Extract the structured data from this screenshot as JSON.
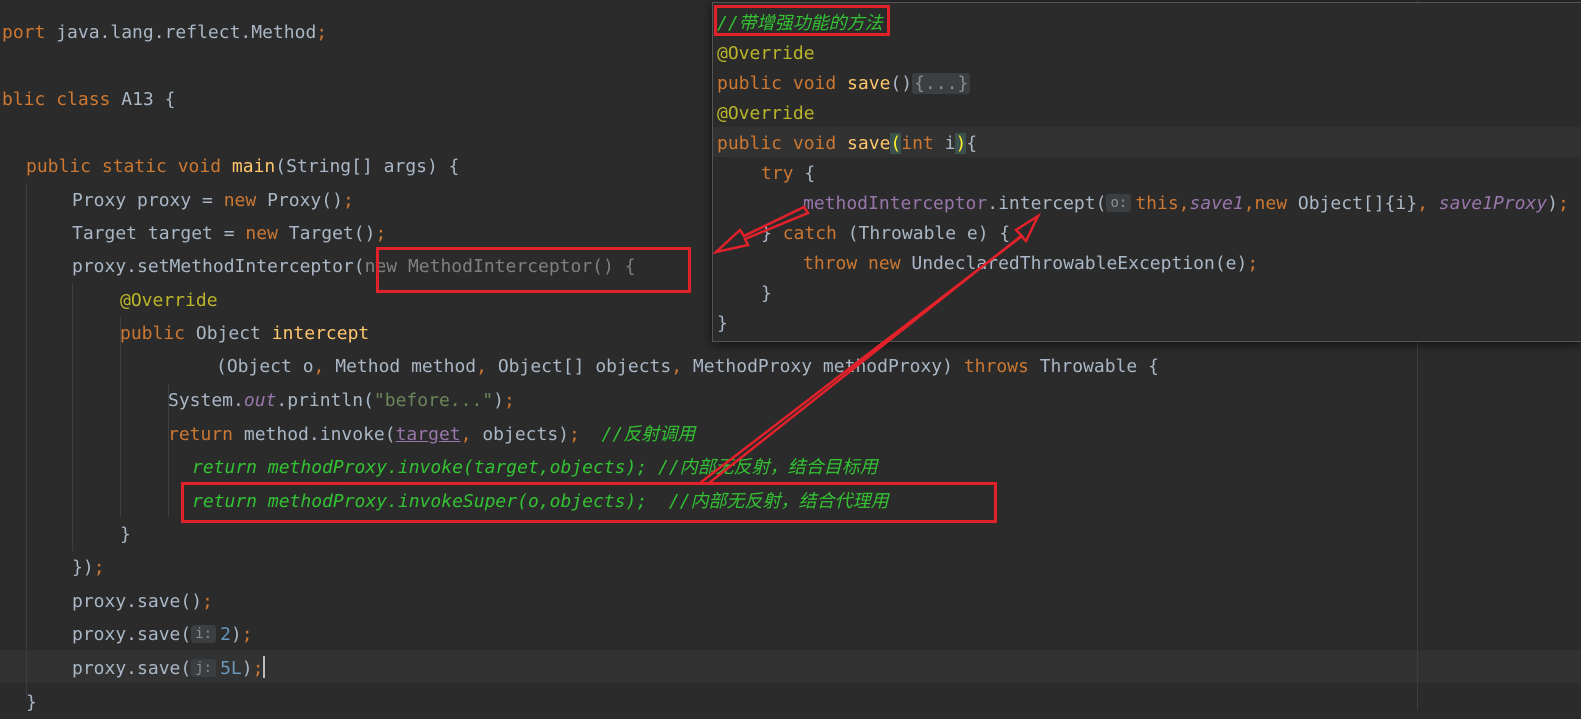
{
  "editor": {
    "line1": {
      "kw": "port",
      "rest": " java.lang.reflect.Method",
      "semi": ";"
    },
    "line2": {
      "kw1": "blic",
      "kw2": "class",
      "name": "A13",
      "brace": " {"
    },
    "line3": {
      "mod": "public static void",
      "fn": "main",
      "rest": "(String[] args) {"
    },
    "line4": {
      "pre": "Proxy proxy = ",
      "kw": "new",
      "rest": " Proxy()",
      "semi": ";"
    },
    "line5": {
      "pre": "Target target = ",
      "kw": "new",
      "rest": " Target()",
      "semi": ";"
    },
    "line6": {
      "pre": "proxy.setMethodInterceptor(",
      "anon": "new MethodInterceptor() {"
    },
    "line7": {
      "ann": "@Override"
    },
    "line8": {
      "kw": "public",
      "type": " Object ",
      "fn": "intercept"
    },
    "line9": {
      "p1": "(Object o",
      "c1": ", ",
      "p2": "Method method",
      "c2": ", ",
      "p3": "Object[] objects",
      "c3": ", ",
      "p4": "MethodProxy methodProxy) ",
      "kw": "throws",
      "rest": " Throwable {"
    },
    "line10": {
      "pre": "System.",
      "field": "out",
      "mid": ".println(",
      "str": "\"before...\"",
      "end": ")",
      "semi": ";"
    },
    "line11": {
      "kw": "return",
      "mid": " method.invoke(",
      "target": "target",
      "comma": ", ",
      "rest": "objects)",
      "semi": ";",
      "comment": "  //反射调用"
    },
    "line12": {
      "code": "return methodProxy.invoke(target,objects); //内部无反射，结合目标用"
    },
    "line13": {
      "code": "return methodProxy.invokeSuper(o,objects);  //内部无反射，结合代理用"
    },
    "line14": {
      "text": "}"
    },
    "line15": {
      "text": "})",
      "semi": ";"
    },
    "line16": {
      "pre": "proxy.save()",
      "semi": ";"
    },
    "line17": {
      "pre": "proxy.save(",
      "hint": "i:",
      "num": "2",
      "end": ")",
      "semi": ";"
    },
    "line18": {
      "pre": "proxy.save(",
      "hint": "j:",
      "num": "5L",
      "end": ")",
      "semi": ";"
    },
    "line19": {
      "text": "}"
    }
  },
  "popup": {
    "p1": {
      "comment": "//带增强功能的方法"
    },
    "p2": {
      "ann": "@Override"
    },
    "p3": {
      "kw": "public void",
      "fn": " save",
      "paren": "()",
      "fold": "{...}"
    },
    "p4": {
      "ann": "@Override"
    },
    "p5": {
      "kw": "public void",
      "fn": " save",
      "open": "(",
      "kw2": "int",
      "arg": " i",
      "close": ")",
      "brace": "{"
    },
    "p6": {
      "kw": "try",
      "rest": " {"
    },
    "p7": {
      "field": "methodInterceptor",
      "mid": ".intercept(",
      "hint": "o:",
      "kw1": "this",
      "c1": ",",
      "f1": "save1",
      "c2": ",",
      "kw2": "new",
      "arr": " Object[]{i}",
      "c3": ", ",
      "f2": "save1Proxy",
      "end": ")",
      "semi": ";"
    },
    "p8": {
      "open": "} ",
      "kw": "catch",
      "rest": " (Throwable e) {"
    },
    "p9": {
      "kw1": "throw",
      "kw2": " new",
      "rest": " UndeclaredThrowableException(e)",
      "semi": ";"
    },
    "p10": {
      "text": "}"
    },
    "p11": {
      "text": "}"
    }
  },
  "colors": {
    "background": "#2b2b2b",
    "keyword": "#cc7832",
    "annotation_box": "#e3212b",
    "comment": "#33c233"
  }
}
